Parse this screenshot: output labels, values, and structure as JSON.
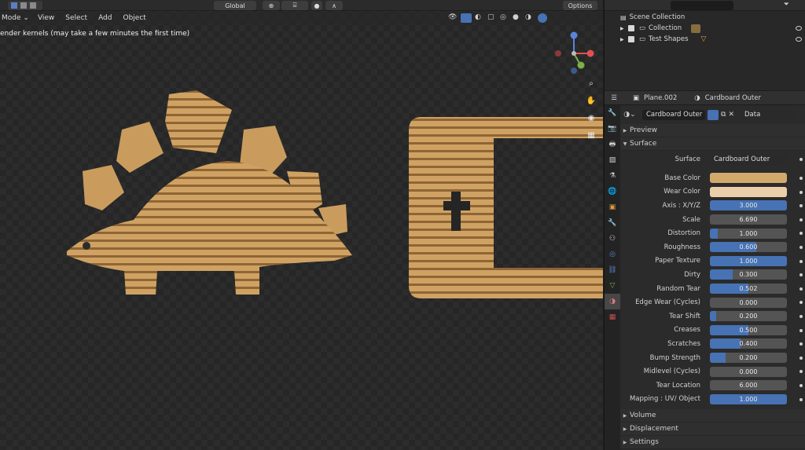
{
  "header": {
    "transform": "Global",
    "options": "Options"
  },
  "menu": {
    "mode": "Mode",
    "items": [
      "View",
      "Select",
      "Add",
      "Object"
    ]
  },
  "status": "ender kernels (may take a few minutes the first time)",
  "outliner": {
    "scene_collection": "Scene Collection",
    "rows": [
      {
        "label": "Collection"
      },
      {
        "label": "Test Shapes"
      }
    ]
  },
  "properties": {
    "object": "Plane.002",
    "material": "Cardboard Outer",
    "slot_material": "Cardboard Outer",
    "link": "Data",
    "panels": {
      "preview": "Preview",
      "surface": "Surface",
      "volume": "Volume",
      "displacement": "Displacement",
      "settings": "Settings"
    },
    "surface_label": "Surface",
    "surface_value": "Cardboard Outer",
    "base_color": {
      "label": "Base Color",
      "color": "#d1a96b"
    },
    "wear_color": {
      "label": "Wear Color",
      "color": "#ebcfaa"
    },
    "sliders": [
      {
        "label": "Axis : X/Y/Z",
        "value": "3.000",
        "fill": 1.0
      },
      {
        "label": "Scale",
        "value": "6.690",
        "fill": 0.0
      },
      {
        "label": "Distortion",
        "value": "1.000",
        "fill": 0.1
      },
      {
        "label": "Roughness",
        "value": "0.600",
        "fill": 0.6
      },
      {
        "label": "Paper Texture",
        "value": "1.000",
        "fill": 1.0
      },
      {
        "label": "Dirty",
        "value": "0.300",
        "fill": 0.3
      },
      {
        "label": "Random Tear",
        "value": "0.502",
        "fill": 0.5
      },
      {
        "label": "Edge Wear (Cycles)",
        "value": "0.000",
        "fill": 0.0
      },
      {
        "label": "Tear Shift",
        "value": "0.200",
        "fill": 0.08
      },
      {
        "label": "Creases",
        "value": "0.500",
        "fill": 0.5
      },
      {
        "label": "Scratches",
        "value": "0.400",
        "fill": 0.4
      },
      {
        "label": "Bump Strength",
        "value": "0.200",
        "fill": 0.2
      },
      {
        "label": "Midlevel (Cycles)",
        "value": "0.000",
        "fill": 0.0
      },
      {
        "label": "Tear Location",
        "value": "6.000",
        "fill": 0.0
      },
      {
        "label": "Mapping : UV/ Object",
        "value": "1.000",
        "fill": 1.0
      }
    ]
  }
}
